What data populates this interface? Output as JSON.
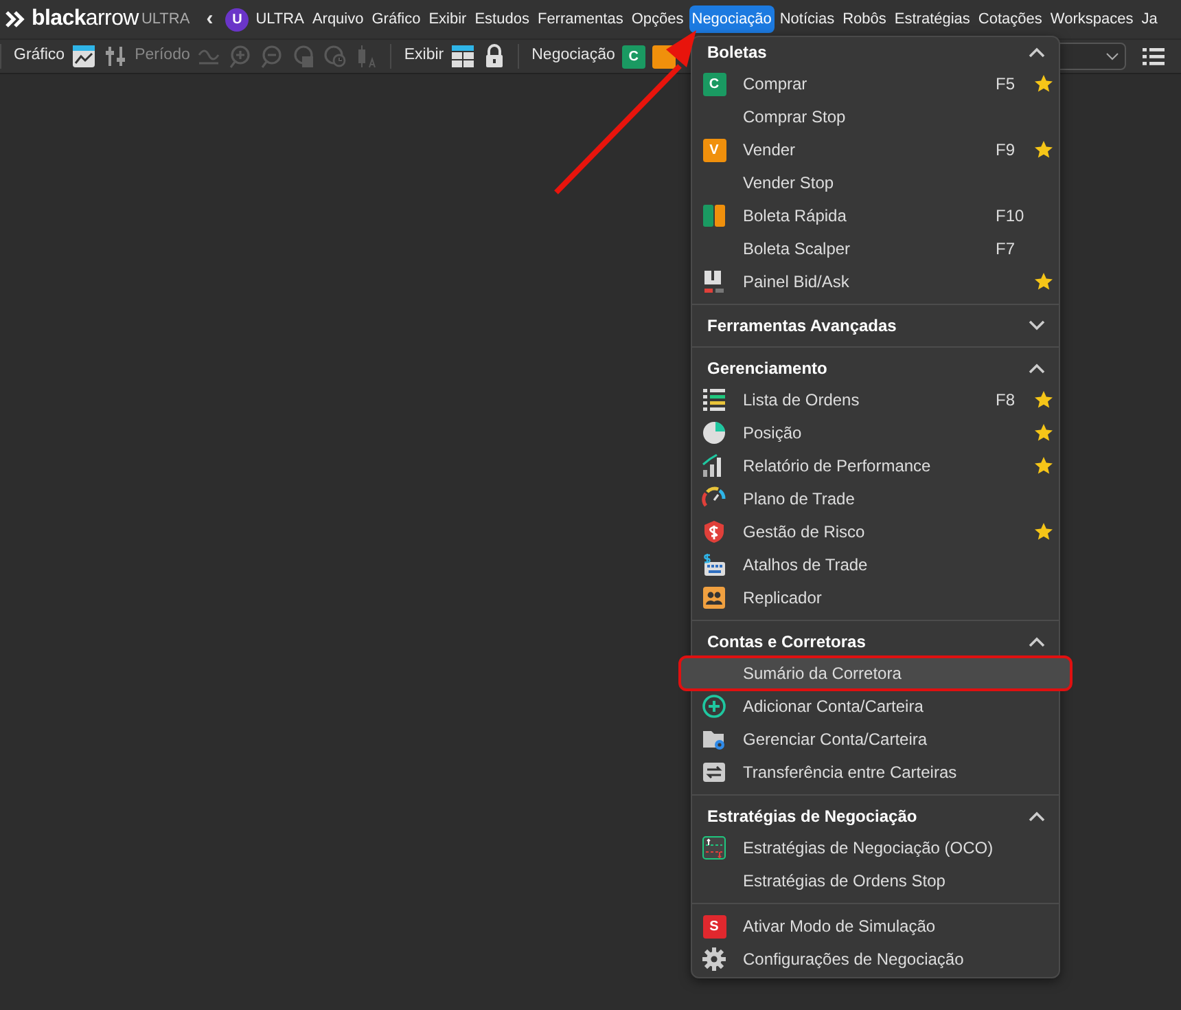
{
  "menu_bar": {
    "logo": {
      "brand": "**black**arrow",
      "edition": "ULTRA"
    },
    "back": "‹",
    "edition_badge": "U",
    "items": [
      {
        "label": "ULTRA",
        "selected": false
      },
      {
        "label": "Arquivo",
        "selected": false
      },
      {
        "label": "Gráfico",
        "selected": false
      },
      {
        "label": "Exibir",
        "selected": false
      },
      {
        "label": "Estudos",
        "selected": false
      },
      {
        "label": "Ferramentas",
        "selected": false
      },
      {
        "label": "Opções",
        "selected": false
      },
      {
        "label": "Negociação",
        "selected": true
      },
      {
        "label": "Notícias",
        "selected": false
      },
      {
        "label": "Robôs",
        "selected": false
      },
      {
        "label": "Estratégias",
        "selected": false
      },
      {
        "label": "Cotações",
        "selected": false
      },
      {
        "label": "Workspaces",
        "selected": false
      },
      {
        "label": "Ja",
        "selected": false
      }
    ]
  },
  "toolbar": {
    "groups": [
      {
        "items": [
          {
            "kind": "label",
            "text": "Gráfico",
            "disabled": false
          },
          {
            "kind": "icon",
            "disabled": false
          },
          {
            "kind": "icon",
            "disabled": false
          },
          {
            "kind": "label",
            "text": "Período",
            "disabled": true
          },
          {
            "kind": "icon",
            "disabled": true
          },
          {
            "kind": "icon",
            "disabled": true
          },
          {
            "kind": "icon",
            "disabled": true
          },
          {
            "kind": "icon",
            "disabled": true
          },
          {
            "kind": "icon",
            "disabled": true
          },
          {
            "kind": "icon",
            "disabled": true
          }
        ]
      },
      {
        "items": [
          {
            "kind": "label",
            "text": "Exibir",
            "disabled": false
          },
          {
            "kind": "icon",
            "disabled": false
          },
          {
            "kind": "icon",
            "disabled": false
          }
        ]
      },
      {
        "items": [
          {
            "kind": "label",
            "text": "Negociação",
            "disabled": false
          },
          {
            "kind": "badge",
            "text": "C",
            "color": "#1a9a62",
            "disabled": false
          },
          {
            "kind": "badge",
            "color": "#f0900c",
            "disabled": false
          }
        ]
      }
    ]
  },
  "dropdown": {
    "sections": [
      {
        "title": "Boletas",
        "expanded": true,
        "items": [
          {
            "label": "Comprar",
            "kind": "badge",
            "badge": "C",
            "color": "#1a9a62",
            "shortcut": "F5",
            "favorite": true,
            "selected": false,
            "outlined": false
          },
          {
            "label": "Comprar Stop",
            "kind": "plain",
            "favorite": false,
            "selected": false,
            "outlined": false
          },
          {
            "label": "Vender",
            "kind": "badge",
            "badge": "V",
            "color": "#f0900c",
            "shortcut": "F9",
            "favorite": true,
            "selected": false,
            "outlined": false
          },
          {
            "label": "Vender Stop",
            "kind": "plain",
            "favorite": false,
            "selected": false,
            "outlined": false
          },
          {
            "label": "Boleta Rápida",
            "kind": "icon",
            "shortcut": "F10",
            "favorite": false,
            "selected": false,
            "outlined": false
          },
          {
            "label": "Boleta Scalper",
            "kind": "plain",
            "shortcut": "F7",
            "favorite": false,
            "selected": false,
            "outlined": false
          },
          {
            "label": "Painel Bid/Ask",
            "kind": "icon",
            "favorite": true,
            "selected": false,
            "outlined": false
          }
        ]
      },
      {
        "title": "Ferramentas Avançadas",
        "expanded": false
      },
      {
        "title": "Gerenciamento",
        "expanded": true,
        "items": [
          {
            "label": "Lista de Ordens",
            "kind": "icon",
            "shortcut": "F8",
            "favorite": true,
            "selected": false,
            "outlined": false
          },
          {
            "label": "Posição",
            "kind": "icon",
            "favorite": true,
            "selected": false,
            "outlined": false
          },
          {
            "label": "Relatório de Performance",
            "kind": "icon",
            "favorite": true,
            "selected": false,
            "outlined": false
          },
          {
            "label": "Plano de Trade",
            "kind": "icon",
            "favorite": false,
            "selected": false,
            "outlined": false
          },
          {
            "label": "Gestão de Risco",
            "kind": "icon",
            "favorite": true,
            "selected": false,
            "outlined": false
          },
          {
            "label": "Atalhos de Trade",
            "kind": "icon",
            "favorite": false,
            "selected": false,
            "outlined": false
          },
          {
            "label": "Replicador",
            "kind": "icon",
            "favorite": false,
            "selected": false,
            "outlined": false
          }
        ]
      },
      {
        "title": "Contas e Corretoras",
        "expanded": true,
        "items": [
          {
            "label": "Sumário da Corretora",
            "kind": "plain",
            "favorite": false,
            "selected": true,
            "outlined": true
          },
          {
            "label": "Adicionar Conta/Carteira",
            "kind": "icon",
            "favorite": false,
            "selected": false,
            "outlined": false
          },
          {
            "label": "Gerenciar Conta/Carteira",
            "kind": "icon",
            "favorite": false,
            "selected": false,
            "outlined": false
          },
          {
            "label": "Transferência entre Carteiras",
            "kind": "icon",
            "favorite": false,
            "selected": false,
            "outlined": false
          }
        ]
      },
      {
        "title": "Estratégias de Negociação",
        "expanded": true,
        "items": [
          {
            "label": "Estratégias de Negociação (OCO)",
            "kind": "icon",
            "favorite": false,
            "selected": false,
            "outlined": false
          },
          {
            "label": "Estratégias de Ordens Stop",
            "kind": "plain",
            "favorite": false,
            "selected": false,
            "outlined": false
          }
        ]
      },
      {
        "items": [
          {
            "label": "Ativar Modo de Simulação",
            "kind": "badge",
            "badge": "S",
            "color": "#e0282e",
            "favorite": false,
            "selected": false,
            "outlined": false
          },
          {
            "label": "Configurações de Negociação",
            "kind": "icon",
            "favorite": false,
            "selected": false,
            "outlined": false
          }
        ]
      }
    ]
  }
}
